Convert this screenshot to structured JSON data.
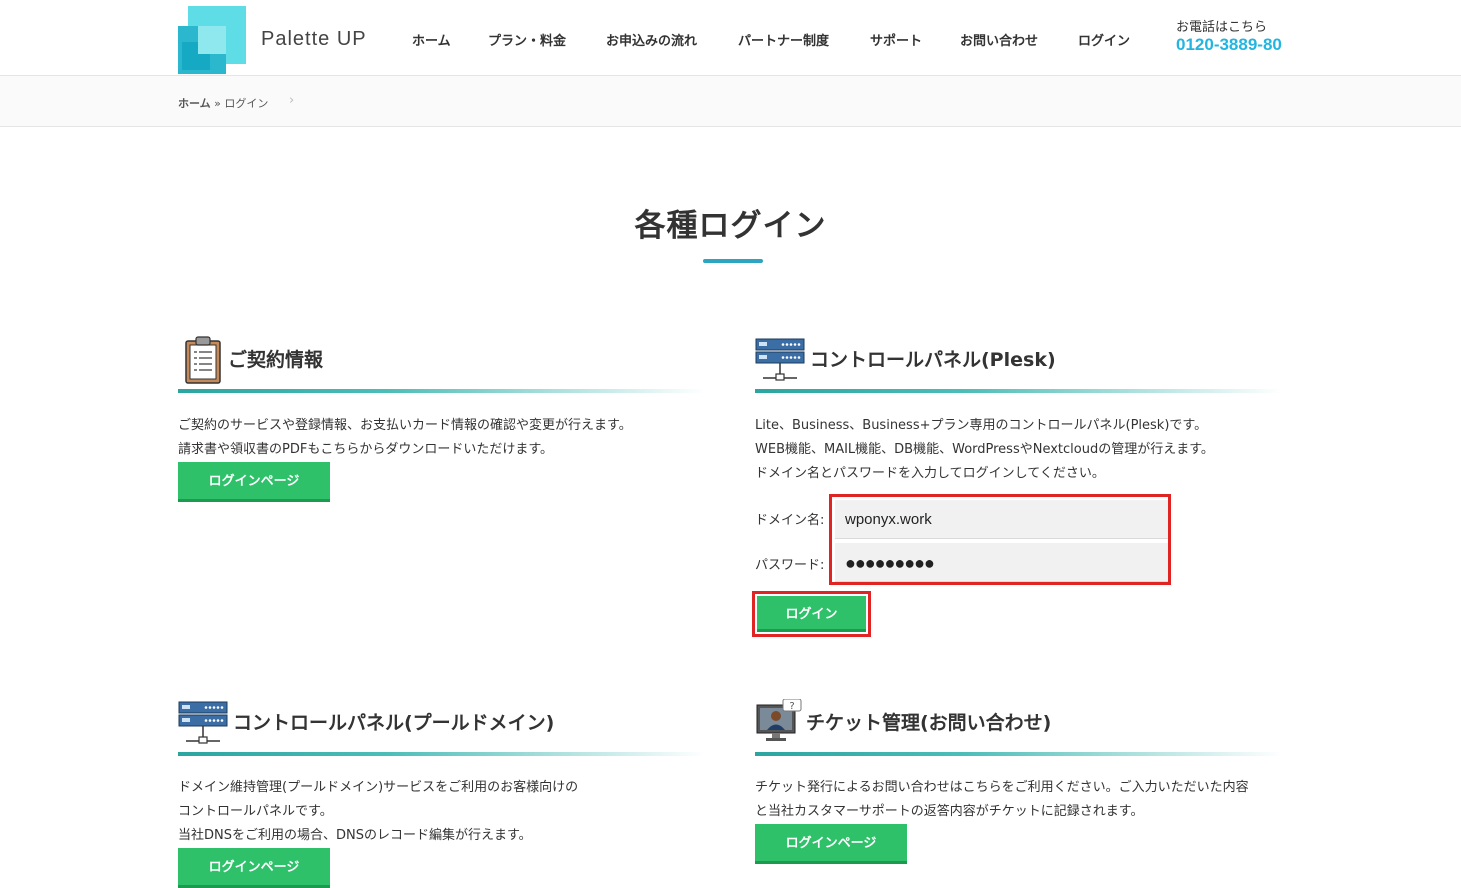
{
  "header": {
    "logo_text": "Palette UP",
    "nav": [
      "ホーム",
      "プラン・料金",
      "お申込みの流れ",
      "パートナー制度",
      "サポート",
      "お問い合わせ",
      "ログイン"
    ],
    "phone_label": "お電話はこちら",
    "phone_number": "0120-3889-80"
  },
  "breadcrumb": {
    "home": "ホーム",
    "separator": "»",
    "current": "ログイン"
  },
  "page": {
    "title": "各種ログイン"
  },
  "sections": {
    "contract": {
      "title": "ご契約情報",
      "lines": [
        "ご契約のサービスや登録情報、お支払いカード情報の確認や変更が行えます。",
        "請求書や領収書のPDFもこちらからダウンロードいただけます。"
      ],
      "button": "ログインページ"
    },
    "plesk": {
      "title": "コントロールパネル(Plesk)",
      "lines": [
        "Lite、Business、Business+プラン専用のコントロールパネル(Plesk)です。",
        "WEB機能、MAIL機能、DB機能、WordPressやNextcloudの管理が行えます。",
        "ドメイン名とパスワードを入力してログインしてください。"
      ],
      "domain_label": "ドメイン名:",
      "domain_value": "wponyx.work",
      "password_label": "パスワード:",
      "password_value": "●●●●●●●●●",
      "button": "ログイン"
    },
    "pool": {
      "title": "コントロールパネル(プールドメイン)",
      "lines": [
        "ドメイン維持管理(プールドメイン)サービスをご利用のお客様向けの",
        "コントロールパネルです。",
        "当社DNSをご利用の場合、DNSのレコード編集が行えます。"
      ],
      "button": "ログインページ"
    },
    "ticket": {
      "title": "チケット管理(お問い合わせ)",
      "lines": [
        "チケット発行によるお問い合わせはこちらをご利用ください。ご入力いただいた内容",
        "と当社カスタマーサポートの返答内容がチケットに記録されます。"
      ],
      "button": "ログインページ"
    }
  },
  "colors": {
    "accent": "#2ba5c0",
    "button": "#2ec16a",
    "highlight": "#e02424",
    "phone": "#23b5e0"
  }
}
